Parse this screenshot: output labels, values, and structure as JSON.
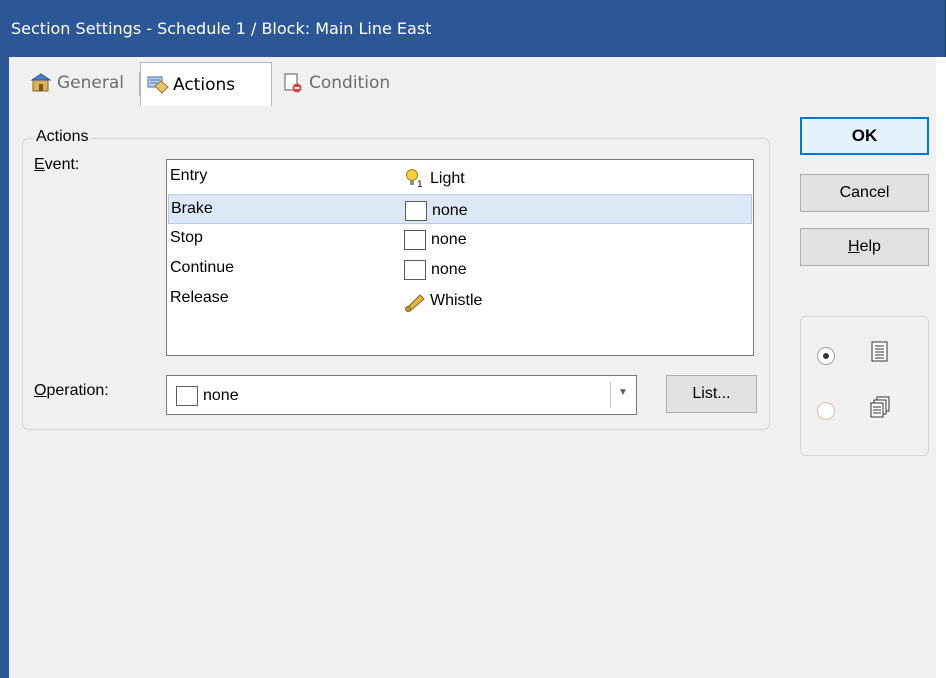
{
  "window": {
    "title": "Section Settings - Schedule 1 / Block: Main Line East"
  },
  "tabs": [
    {
      "label": "General",
      "icon": "general-icon",
      "active": false
    },
    {
      "label": "Actions",
      "icon": "actions-icon",
      "active": true
    },
    {
      "label": "Condition",
      "icon": "condition-icon",
      "active": false
    }
  ],
  "actions": {
    "group_label": "Actions",
    "event_label_accel": "E",
    "event_label_rest": "vent:",
    "events": [
      {
        "name": "Entry",
        "action": "Light",
        "icon": "light-bulb-icon",
        "selected": false
      },
      {
        "name": "Brake",
        "action": "none",
        "icon": "empty-checkbox",
        "selected": true
      },
      {
        "name": "Stop",
        "action": "none",
        "icon": "empty-checkbox",
        "selected": false
      },
      {
        "name": "Continue",
        "action": "none",
        "icon": "empty-checkbox",
        "selected": false
      },
      {
        "name": "Release",
        "action": "Whistle",
        "icon": "whistle-icon",
        "selected": false
      }
    ],
    "operation_label_accel": "O",
    "operation_label_rest": "peration:",
    "operation_value": "none",
    "list_button": "List..."
  },
  "buttons": {
    "ok": "OK",
    "cancel": "Cancel",
    "help_accel": "H",
    "help_rest": "elp"
  },
  "view_options": [
    {
      "icon": "single-page-icon",
      "checked": true
    },
    {
      "icon": "multi-page-icon",
      "checked": false
    }
  ],
  "colors": {
    "titlebar": "#2b5797",
    "selection": "#dde8f6",
    "ok_border": "#0078d7"
  }
}
